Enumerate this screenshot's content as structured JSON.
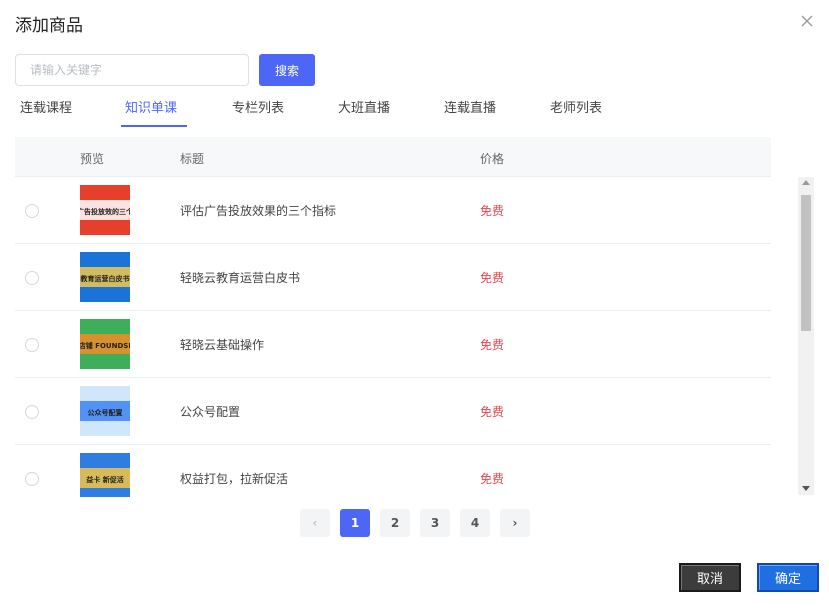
{
  "dialog": {
    "title": "添加商品"
  },
  "search": {
    "placeholder": "请输入关键字",
    "value": "",
    "button_label": "搜索"
  },
  "tabs": [
    {
      "label": "连载课程",
      "active": false
    },
    {
      "label": "知识单课",
      "active": true
    },
    {
      "label": "专栏列表",
      "active": false
    },
    {
      "label": "大班直播",
      "active": false
    },
    {
      "label": "连载直播",
      "active": false
    },
    {
      "label": "老师列表",
      "active": false
    }
  ],
  "table": {
    "columns": [
      "预览",
      "标题",
      "价格"
    ],
    "rows": [
      {
        "title": "评估广告投放效果的三个指标",
        "price": "免费",
        "thumb_text": "评估广告投放效的三个指标",
        "thumb_colors": [
          "#e63f2b",
          "#ffffff"
        ]
      },
      {
        "title": "轻晓云教育运营白皮书",
        "price": "免费",
        "thumb_text": "教育运营白皮书",
        "thumb_colors": [
          "#1a73d9",
          "#f2c94c"
        ]
      },
      {
        "title": "轻晓云基础操作",
        "price": "免费",
        "thumb_text": "创建店铺 FOUNDSHOP",
        "thumb_colors": [
          "#3fae5a",
          "#f28c28"
        ]
      },
      {
        "title": "公众号配置",
        "price": "免费",
        "thumb_text": "公众号配置",
        "thumb_colors": [
          "#cfe6fb",
          "#3b82f6"
        ]
      },
      {
        "title": "权益打包，拉新促活",
        "price": "免费",
        "thumb_text": "益卡 新促活",
        "thumb_colors": [
          "#2f7de1",
          "#f5c542"
        ]
      }
    ]
  },
  "pagination": {
    "prev": "‹",
    "pages": [
      "1",
      "2",
      "3",
      "4"
    ],
    "current": "1",
    "next": "›"
  },
  "footer": {
    "cancel_label": "取消",
    "confirm_label": "确定"
  },
  "colors": {
    "accent": "#4c67f5",
    "price": "#e5484d"
  },
  "icons": {
    "close": "close-icon"
  }
}
